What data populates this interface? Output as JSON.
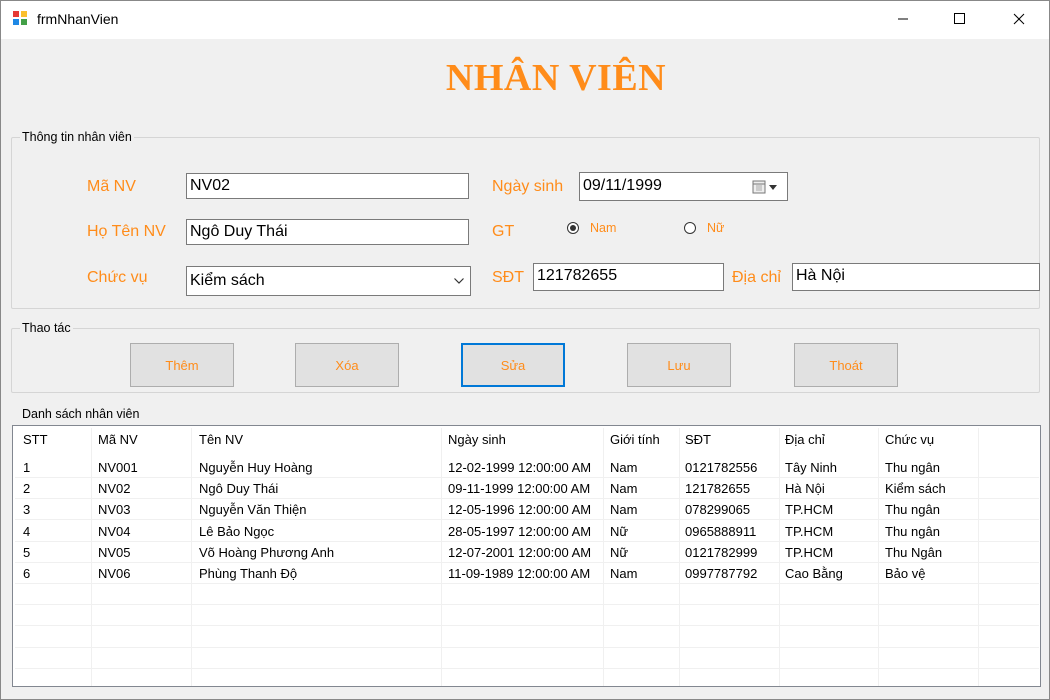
{
  "window": {
    "title": "frmNhanVien"
  },
  "heading": "NHÂN VIÊN",
  "info_group": {
    "label": "Thông tin nhân viên",
    "ma_nv_label": "Mã NV",
    "ma_nv_value": "NV02",
    "ho_ten_label": "Họ Tên NV",
    "ho_ten_value": "Ngô Duy Thái",
    "chuc_vu_label": "Chức vụ",
    "chuc_vu_value": "Kiểm sách",
    "ngay_sinh_label": "Ngày sinh",
    "ngay_sinh_value": "09/11/1999",
    "gt_label": "GT",
    "gt_options": [
      "Nam",
      "Nữ"
    ],
    "gt_selected": "Nam",
    "sdt_label": "SĐT",
    "sdt_value": "121782655",
    "dia_chi_label": "Địa chỉ",
    "dia_chi_value": "Hà Nội"
  },
  "actions_group": {
    "label": "Thao tác",
    "buttons": [
      "Thêm",
      "Xóa",
      "Sửa",
      "Lưu",
      "Thoát"
    ],
    "focused": "Sửa"
  },
  "list_group": {
    "label": "Danh sách nhân viên",
    "columns": [
      "STT",
      "Mã NV",
      "Tên NV",
      "Ngày sinh",
      "Giới tính",
      "SĐT",
      "Địa chỉ",
      "Chức vụ"
    ],
    "rows": [
      [
        "1",
        "NV001",
        "Nguyễn Huy Hoàng",
        "12-02-1999 12:00:00 AM",
        "Nam",
        "0121782556",
        "Tây Ninh",
        "Thu ngân"
      ],
      [
        "2",
        "NV02",
        "Ngô Duy Thái",
        "09-11-1999 12:00:00 AM",
        "Nam",
        "121782655",
        "Hà Nội",
        "Kiểm sách"
      ],
      [
        "3",
        "NV03",
        "Nguyễn Văn Thiện",
        "12-05-1996 12:00:00 AM",
        "Nam",
        "078299065",
        "TP.HCM",
        "Thu ngân"
      ],
      [
        "4",
        "NV04",
        "Lê Bảo Ngọc",
        "28-05-1997 12:00:00 AM",
        "Nữ",
        "0965888911",
        "TP.HCM",
        "Thu ngân"
      ],
      [
        "5",
        "NV05",
        "Võ Hoàng Phương Anh",
        "12-07-2001 12:00:00 AM",
        "Nữ",
        "0121782999",
        "TP.HCM",
        "Thu Ngân"
      ],
      [
        "6",
        "NV06",
        "Phùng Thanh Độ",
        "11-09-1989 12:00:00 AM",
        "Nam",
        "0997787792",
        "Cao Bằng",
        "Bảo vệ"
      ]
    ]
  },
  "colors": {
    "accent": "#ff8c1a",
    "focus": "#0078d7"
  }
}
